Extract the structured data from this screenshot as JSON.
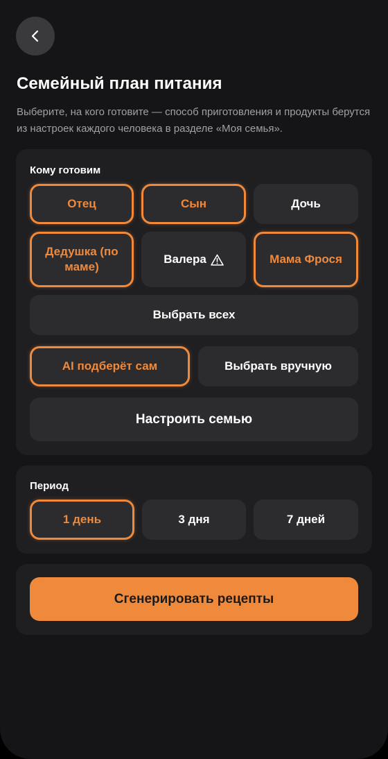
{
  "header": {
    "back_icon": "chevron-left-icon",
    "title": "Семейный план питания",
    "subtitle": "Выберите, на кого готовите — способ приготовления и продукты берутся из настроек каждого человека в разделе «Моя семья»."
  },
  "who": {
    "label": "Кому готовим",
    "members": [
      {
        "label": "Отец",
        "selected": true
      },
      {
        "label": "Сын",
        "selected": true
      },
      {
        "label": "Дочь",
        "selected": false
      },
      {
        "label": "Дедушка (по маме)",
        "selected": true
      },
      {
        "label": "Валера",
        "selected": false,
        "icon": "warning-icon"
      },
      {
        "label": "Мама Фрося",
        "selected": true
      }
    ],
    "select_all": "Выбрать всех",
    "mode": [
      {
        "label": "AI подберёт сам",
        "selected": true
      },
      {
        "label": "Выбрать вручную",
        "selected": false
      }
    ],
    "configure_family": "Настроить семью"
  },
  "period": {
    "label": "Период",
    "options": [
      {
        "label": "1 день",
        "selected": true
      },
      {
        "label": "3 дня",
        "selected": false
      },
      {
        "label": "7 дней",
        "selected": false
      }
    ]
  },
  "generate": {
    "label": "Сгенерировать рецепты"
  },
  "colors": {
    "accent": "#f08a3a",
    "background": "#151517",
    "card": "#1f1f22",
    "chip": "#2c2c2f"
  }
}
